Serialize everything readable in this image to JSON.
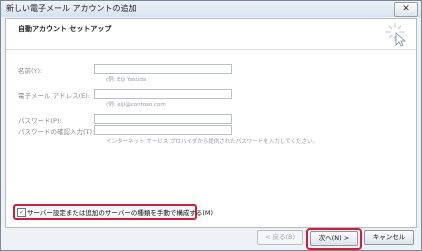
{
  "window": {
    "title": "新しい電子メール アカウントの追加",
    "close_glyph": "✕"
  },
  "header": {
    "title": "自動アカウント セットアップ",
    "icon": "wizard-cursor-icon"
  },
  "form": {
    "name_label": "名前(Y):",
    "name_hint": "(例: Eiji Yasuda",
    "email_label": "電子メール アドレス(E):",
    "email_hint": "(例: eiji@contoso.com",
    "password_label": "パスワード(P):",
    "password_confirm_label": "パスワードの確認入力(T):",
    "password_hint": "インターネット サービス プロバイダから提供されたパスワードを入力してください。"
  },
  "manual_config": {
    "checked": true,
    "check_glyph": "✓",
    "label": "サーバー設定または追加のサーバーの種類を手動で構成する(M)"
  },
  "buttons": {
    "back": "< 戻る(B)",
    "next": "次へ(N) >",
    "cancel": "キャンセル"
  },
  "colors": {
    "highlight": "#cc1f3a"
  }
}
